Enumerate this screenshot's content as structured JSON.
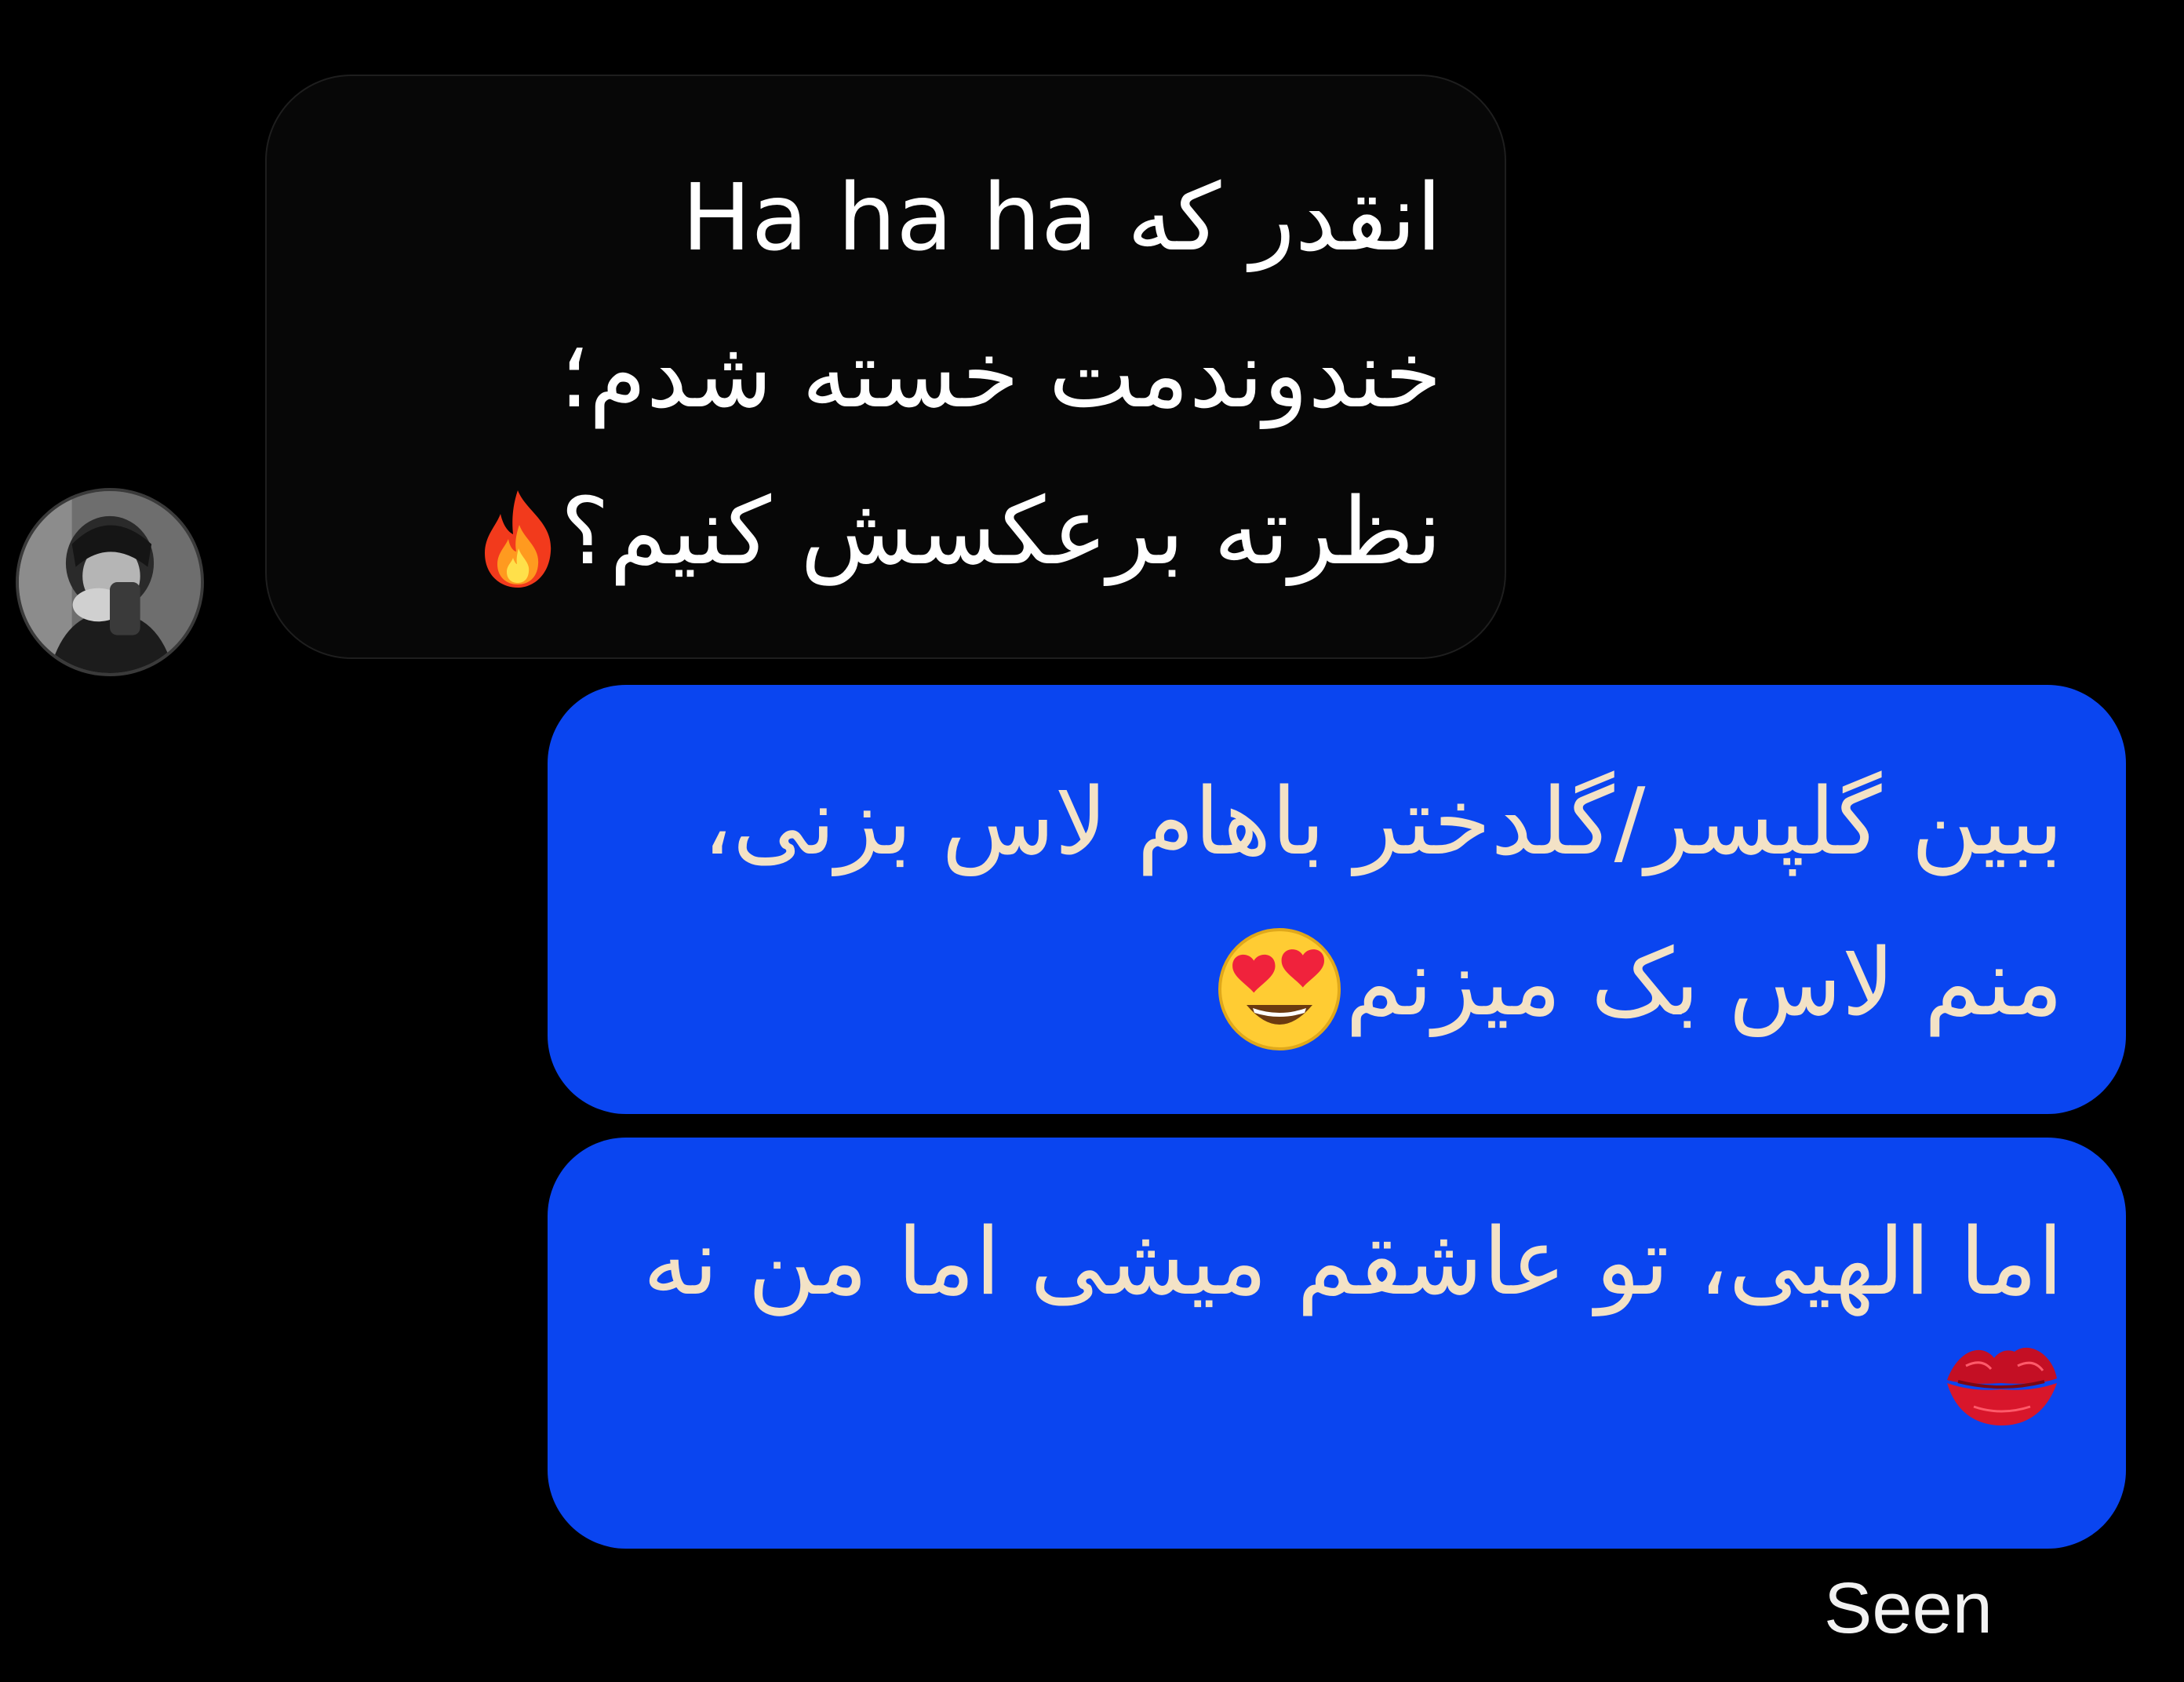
{
  "conversation": {
    "received_message": {
      "lines": [
        "انقدر که Ha ha ha",
        "خندوندمت خسته شدم؛",
        "نظرته برعکسش کنیم؟"
      ],
      "trailing_emoji": "fire-emoji"
    },
    "sent_messages": [
      {
        "lines": [
          "ببین گلپسر/گلدختر باهام لاس بزنی،",
          "منم لاس بک میزنم"
        ],
        "trailing_emoji": "heart-eyes-emoji"
      },
      {
        "lines": [
          "اما الهیی، تو عاشقم میشی اما من نه"
        ],
        "trailing_emoji": "kiss-mark-emoji"
      }
    ],
    "status": "Seen"
  },
  "colors": {
    "background": "#000000",
    "received_bubble": "#070707",
    "sent_bubble": "#0a45f0",
    "received_text": "#ffffff",
    "sent_text": "#f3e2c6",
    "status_text": "#f2f2f2"
  }
}
